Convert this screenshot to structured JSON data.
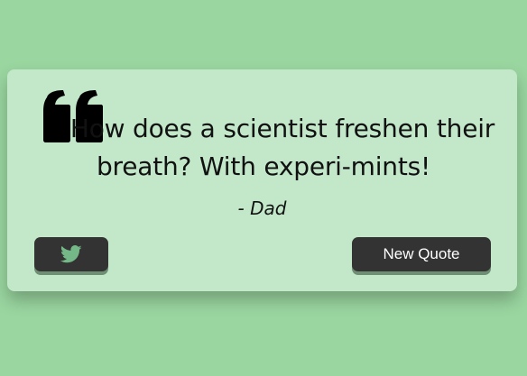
{
  "colors": {
    "background": "#9ad6a0",
    "card": "#c3e8c9",
    "button": "#333333",
    "button_text": "#ffffff",
    "icon": "#74b887",
    "text": "#111111"
  },
  "quote": {
    "icon": "quote-left-icon",
    "text": "How does a scientist freshen their breath? With experi-mints!",
    "author": "- Dad"
  },
  "actions": {
    "tweet_icon": "twitter-icon",
    "new_quote_label": "New Quote"
  }
}
